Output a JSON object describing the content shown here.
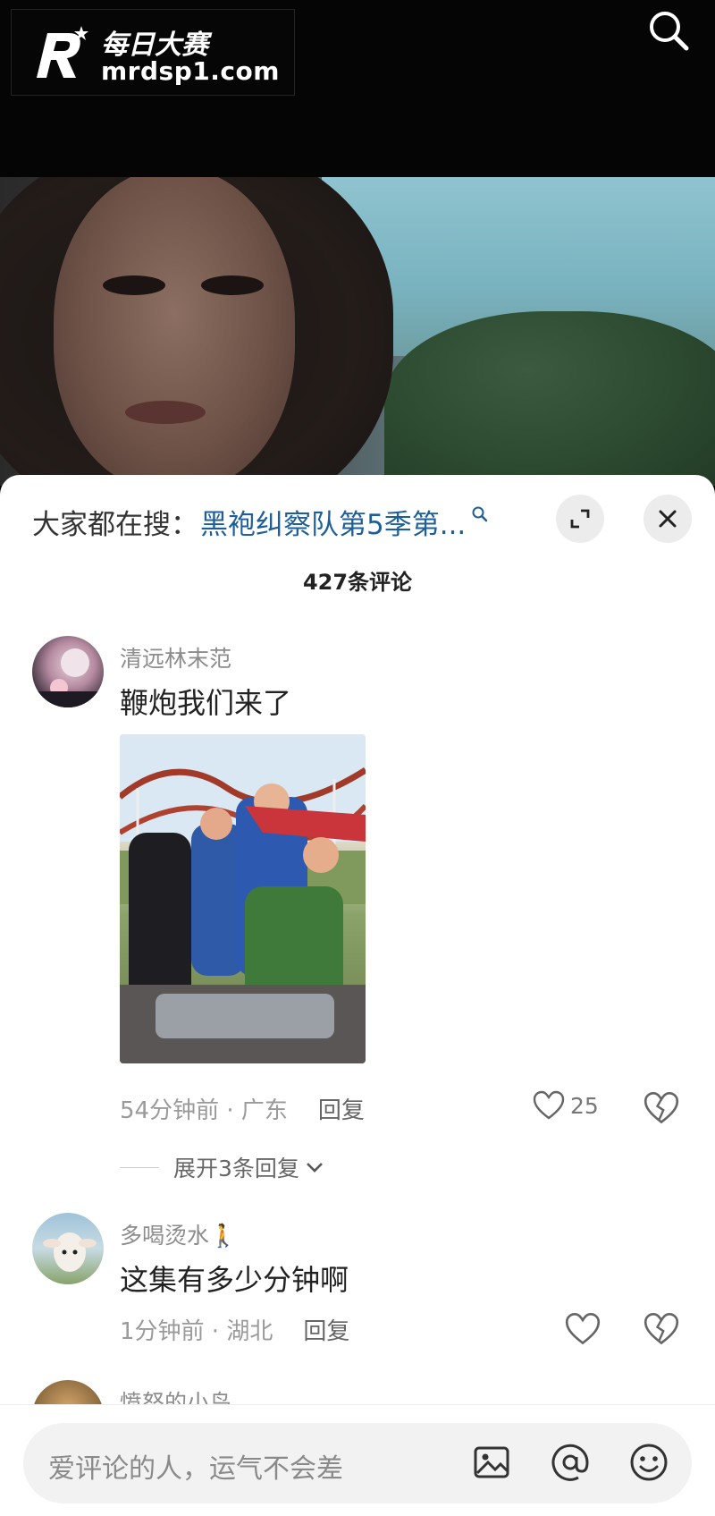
{
  "logo": {
    "brand_cn": "每日大赛",
    "domain": "mrdsp1.com"
  },
  "hot_search": {
    "label": "大家都在搜：",
    "term": "黑袍纠察队第5季第..."
  },
  "comment_count": "427条评论",
  "comments": [
    {
      "user": "清远林末范",
      "text": "鞭炮我们来了",
      "time_loc": "54分钟前 · 广东",
      "reply_label": "回复",
      "likes": "25",
      "expand_label": "展开3条回复"
    },
    {
      "user": "多喝烫水🚶",
      "text": "这集有多少分钟啊",
      "time_loc": "1分钟前 · 湖北",
      "reply_label": "回复"
    },
    {
      "user": "愤怒的小鸟"
    }
  ],
  "input": {
    "placeholder": "爱评论的人，运气不会差"
  },
  "icons": [
    "search-icon",
    "expand-icon",
    "close-icon",
    "heart-icon",
    "broken-heart-icon",
    "chevron-down-icon",
    "image-icon",
    "at-icon",
    "emoji-icon"
  ],
  "colors": {
    "accent_link": "#1f5f97",
    "sheet_bg": "#ffffff",
    "top_bg": "#050505"
  }
}
